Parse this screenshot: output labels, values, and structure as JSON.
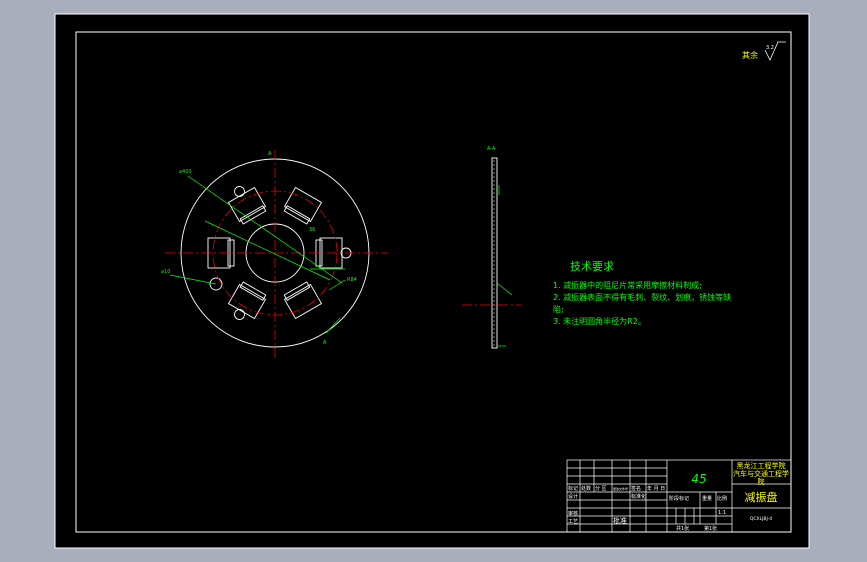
{
  "colors": {
    "background": "#a9aebc",
    "sheet": "#000000",
    "frame": "#ffffff",
    "center_line": "#ff0000",
    "dimension": "#00ff00",
    "title_text": "#ffff00",
    "material_text": "#00ff00"
  },
  "roughness_note": {
    "label": "其余",
    "value": "3.2"
  },
  "section_view": {
    "label": "A-A"
  },
  "front_view": {
    "section_mark": "A",
    "dim_large_hole": "⌀400",
    "dim_small_hole": "⌀10",
    "dim_slot": "36",
    "dim_pitch": "R84"
  },
  "technical_requirements": {
    "heading": "技术要求",
    "items": [
      "1. 减振器中的阻尼片常采用摩擦材料制成;",
      "2. 减振器表面不得有毛刺、裂纹、划痕，锈蚀等缺",
      "陷;",
      "3. 未注明圆角半径为R2。"
    ]
  },
  "title_block": {
    "material": "45",
    "school": [
      "黑龙江工程学院",
      "汽车与交通工程学",
      "院"
    ],
    "part_name": "减振盘",
    "drawing_number": "QCXLJBJ-4",
    "row_labels": [
      "标记",
      "处数",
      "分 区",
      "更改文件号",
      "签名",
      "年 月 日"
    ],
    "design": "设计",
    "standardize": "标准化",
    "stage_mark": "阶段标记",
    "weight": "重量",
    "scale_label": "比例",
    "scale": "1:1",
    "review": "审核",
    "process": "工艺",
    "approve": "批准",
    "sheets_total": "共1张",
    "sheet_no": "第1张"
  }
}
